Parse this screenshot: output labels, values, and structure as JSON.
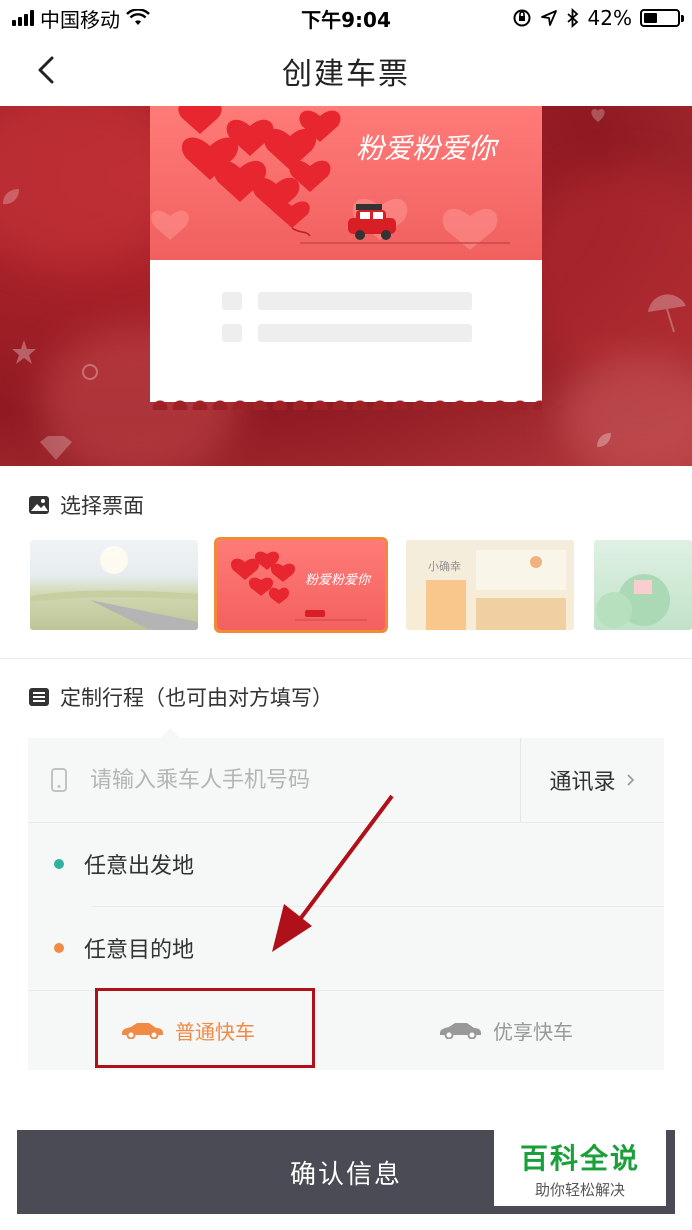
{
  "status_bar": {
    "carrier": "中国移动",
    "time": "下午9:04",
    "battery_text": "42%",
    "battery_level": 0.42
  },
  "nav": {
    "title": "创建车票",
    "back_icon": "chevron-left-icon"
  },
  "hero_ticket": {
    "banner_text": "粉爱粉爱你"
  },
  "ticket_face": {
    "header": "选择票面",
    "options": [
      {
        "name": "road",
        "selected": false
      },
      {
        "name": "hearts",
        "selected": true,
        "caption": "粉爱粉爱你"
      },
      {
        "name": "cafe",
        "selected": false,
        "caption": "小确幸"
      },
      {
        "name": "garden",
        "selected": false
      }
    ]
  },
  "itinerary": {
    "header": "定制行程（也可由对方填写）",
    "phone_placeholder": "请输入乘车人手机号码",
    "contacts_label": "通讯录",
    "departure_label": "任意出发地",
    "destination_label": "任意目的地",
    "departure_color": "#2bb5a0",
    "destination_color": "#f08a45"
  },
  "car_types": {
    "items": [
      {
        "label": "普通快车",
        "selected": true,
        "color": "#f08a45"
      },
      {
        "label": "优享快车",
        "selected": false,
        "color": "#999999"
      }
    ]
  },
  "confirm": {
    "label": "确认信息"
  },
  "watermark": {
    "title": "百科全说",
    "subtitle": "助你轻松解决"
  }
}
